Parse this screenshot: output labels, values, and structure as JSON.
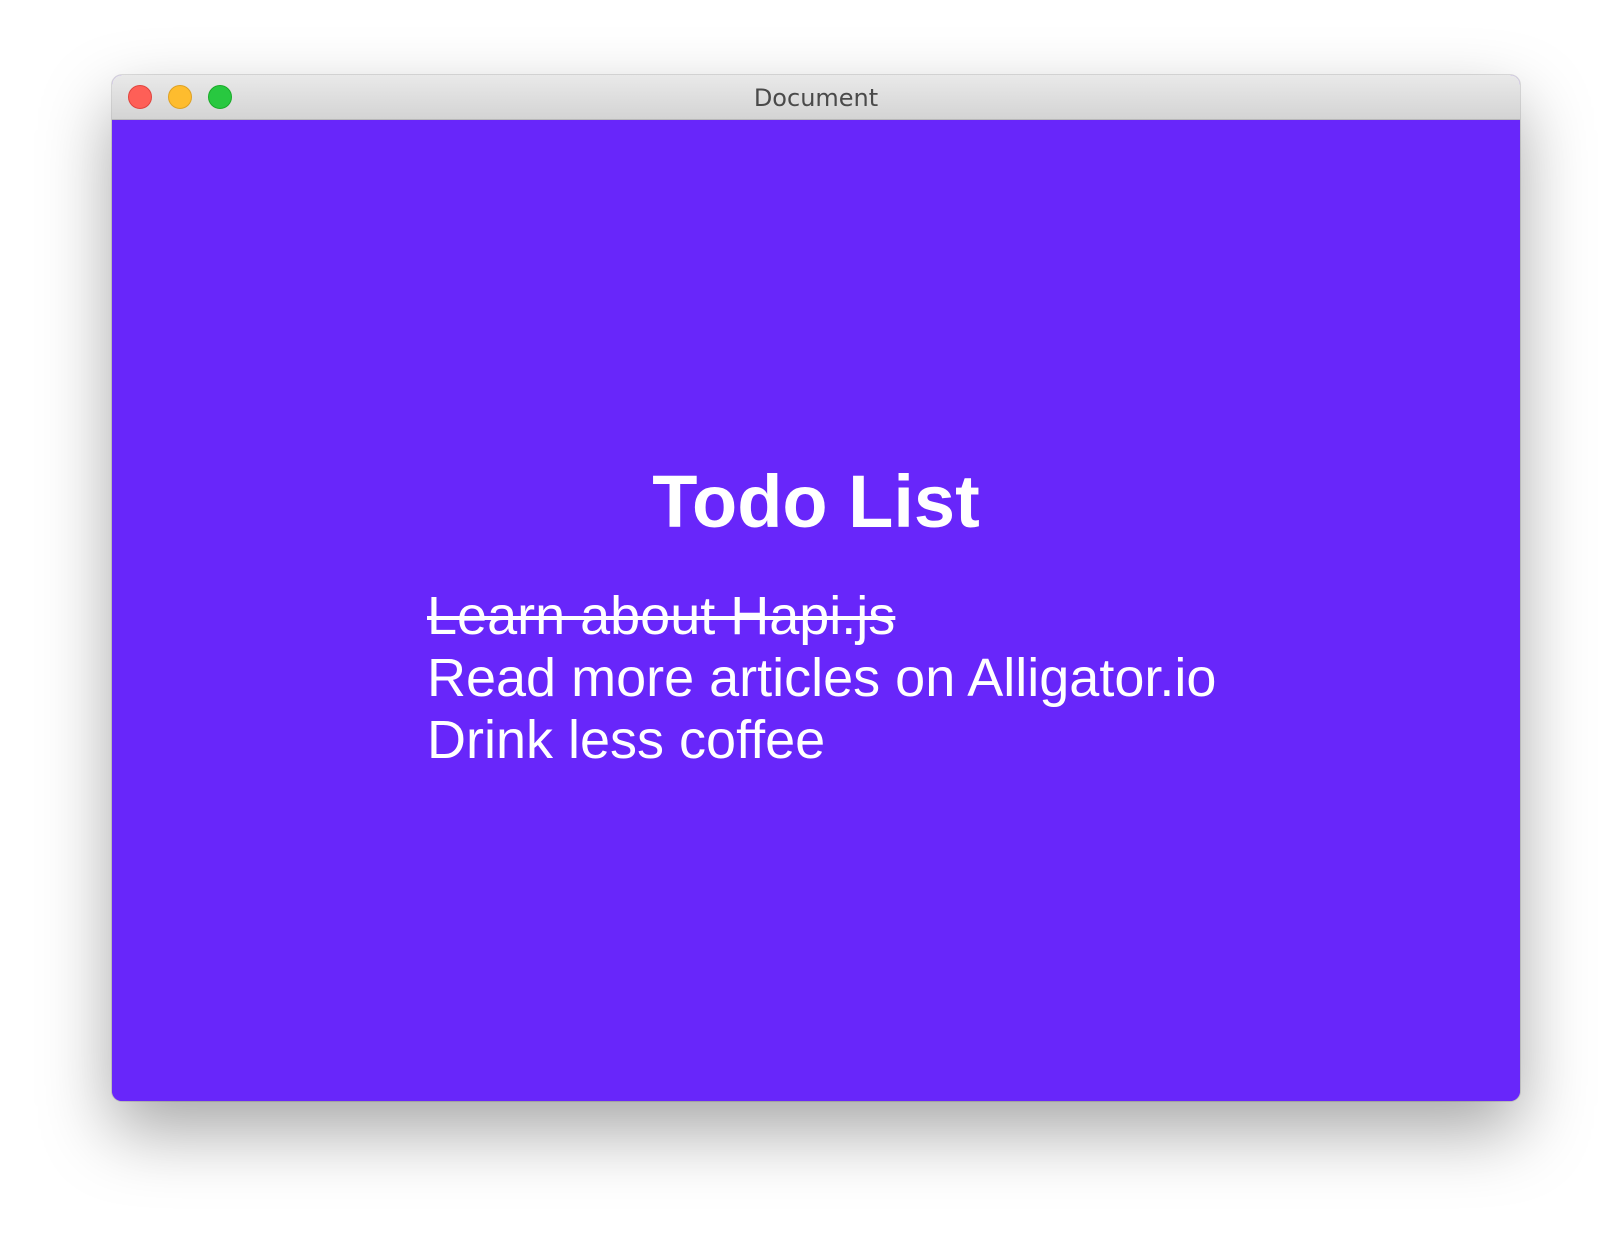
{
  "window": {
    "title": "Document"
  },
  "page": {
    "heading": "Todo List",
    "background_color": "#6826fa",
    "text_color": "#ffffff"
  },
  "todos": [
    {
      "text": "Learn about Hapi.js",
      "completed": true
    },
    {
      "text": "Read more articles on Alligator.io",
      "completed": false
    },
    {
      "text": "Drink less coffee",
      "completed": false
    }
  ]
}
